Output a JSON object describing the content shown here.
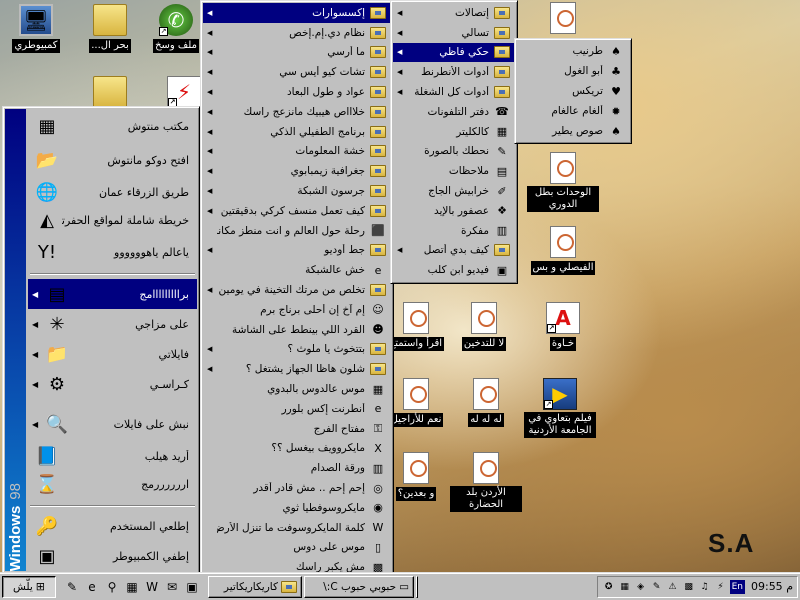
{
  "desktop": {
    "icons": [
      {
        "label": "كمبيوطري",
        "glyph": "🖥"
      },
      {
        "label": "بحر ال...",
        "glyph": ""
      },
      {
        "label": "ملف وسخ",
        "glyph": "✆"
      },
      {
        "label": "",
        "glyph": ""
      },
      {
        "label": "",
        "glyph": ""
      },
      {
        "label": "الوحدات بطل الدوري",
        "glyph": ""
      },
      {
        "label": "الفيصلي و بس",
        "glyph": ""
      },
      {
        "label": "اقرأ واستمتع",
        "glyph": ""
      },
      {
        "label": "لا للتدخين",
        "glyph": ""
      },
      {
        "label": "خـاوة",
        "glyph": "A"
      },
      {
        "label": "نعم للأراجيل",
        "glyph": ""
      },
      {
        "label": "له له له",
        "glyph": ""
      },
      {
        "label": "فيلم بتعاوي في الجامعة الأردنية",
        "glyph": "▶"
      },
      {
        "label": "و بعدين؟",
        "glyph": ""
      },
      {
        "label": "الأردن بلد الحضارة",
        "glyph": ""
      },
      {
        "label": "",
        "glyph": ""
      }
    ],
    "watermark": "S.A"
  },
  "start_menu": {
    "banner_bold": "Windows",
    "banner_light": "98",
    "items": [
      {
        "label": "مكتب منتوش",
        "icon": "▦",
        "has_sub": false
      },
      {
        "label": "افتح دوكو مانتوش",
        "icon": "📂",
        "has_sub": false
      },
      {
        "label": "طريق الزرقاء عمان",
        "icon": "🌐",
        "has_sub": false
      },
      {
        "label": "خريطة شاملة لمواقع الحفرتل",
        "icon": "◭",
        "has_sub": false
      },
      {
        "label": "ياعالم ياهوووووو",
        "icon": "Y!",
        "has_sub": false
      },
      {
        "label": "برااااااااامج",
        "icon": "▤",
        "has_sub": true
      },
      {
        "label": "على مزاجي",
        "icon": "✳",
        "has_sub": true
      },
      {
        "label": "فايلاتي",
        "icon": "📁",
        "has_sub": true
      },
      {
        "label": "كـراسـي",
        "icon": "⚙",
        "has_sub": true
      },
      {
        "label": "نبش على فايلات",
        "icon": "🔍",
        "has_sub": true
      },
      {
        "label": "أريد هيلب",
        "icon": "📘",
        "has_sub": false
      },
      {
        "label": "اررررررمج",
        "icon": "⌛",
        "has_sub": false
      },
      {
        "label": "إطلعي المستخدم",
        "icon": "🔑",
        "has_sub": false
      },
      {
        "label": "إطفي الكمبيوطر",
        "icon": "▣",
        "has_sub": false
      }
    ]
  },
  "programs_menu": {
    "items": [
      {
        "label": "إكسسوارات",
        "icon": "folder",
        "has_sub": true
      },
      {
        "label": "نظام دي.إم.إخص",
        "icon": "folder",
        "has_sub": true
      },
      {
        "label": "ما أرسي",
        "icon": "folder",
        "has_sub": true
      },
      {
        "label": "تشات كيو أيس سي",
        "icon": "folder",
        "has_sub": true
      },
      {
        "label": "عواد و طول البعاد",
        "icon": "folder",
        "has_sub": true
      },
      {
        "label": "خلاااص هيبيك مانزعج راسك",
        "icon": "folder",
        "has_sub": true
      },
      {
        "label": "برنامج الطفيلي الذكي",
        "icon": "folder",
        "has_sub": true
      },
      {
        "label": "خشة المعلومات",
        "icon": "folder",
        "has_sub": true
      },
      {
        "label": "جغرافية زيمبابوي",
        "icon": "folder",
        "has_sub": true
      },
      {
        "label": "جرسون الشبكة",
        "icon": "folder",
        "has_sub": true
      },
      {
        "label": "كيف تعمل منسف كركي بدقيقتين",
        "icon": "folder",
        "has_sub": true
      },
      {
        "label": "رحلة حول العالم و انت منطز مكانك",
        "icon": "⬛",
        "has_sub": false
      },
      {
        "label": "جط أوديو",
        "icon": "folder",
        "has_sub": true
      },
      {
        "label": "خش عالشبكة",
        "icon": "e",
        "has_sub": false
      },
      {
        "label": "تخلص من مرتك التخينة في يومين",
        "icon": "folder",
        "has_sub": true
      },
      {
        "label": "إم آخ إن أحلى برناج برم",
        "icon": "☺",
        "has_sub": false
      },
      {
        "label": "القرد اللي بينطط على الشاشة",
        "icon": "☻",
        "has_sub": false
      },
      {
        "label": "بتتخوث يا ملوث ؟",
        "icon": "folder",
        "has_sub": true
      },
      {
        "label": "شلون هاظا الجهاز يشتغل ؟",
        "icon": "folder",
        "has_sub": true
      },
      {
        "label": "موس عالدوس بالبدوي",
        "icon": "▦",
        "has_sub": false
      },
      {
        "label": "أنطرنت إكس بلورر",
        "icon": "e",
        "has_sub": false
      },
      {
        "label": "مفتاح الفرج",
        "icon": "⚿",
        "has_sub": false
      },
      {
        "label": "مايكروويف بيغسل ؟؟",
        "icon": "X",
        "has_sub": false
      },
      {
        "label": "ورقة الصدام",
        "icon": "▥",
        "has_sub": false
      },
      {
        "label": "إحم إحم .. مش قادر أقدر",
        "icon": "◎",
        "has_sub": false
      },
      {
        "label": "مايكروسوفطيا ثوي",
        "icon": "◉",
        "has_sub": false
      },
      {
        "label": "كلمة المايكروسوفت ما تنزل الأرض",
        "icon": "W",
        "has_sub": false
      },
      {
        "label": "موس على دوس",
        "icon": "▯",
        "has_sub": false
      },
      {
        "label": "مش يكبر راسك",
        "icon": "▩",
        "has_sub": false
      }
    ],
    "scroll_down": "▼"
  },
  "accessories_menu": {
    "items": [
      {
        "label": "إتصالات",
        "icon": "folder",
        "has_sub": true
      },
      {
        "label": "تسالي",
        "icon": "folder",
        "has_sub": true
      },
      {
        "label": "حكي فاظي",
        "icon": "folder",
        "has_sub": true
      },
      {
        "label": "أدوات الأنطرنط",
        "icon": "folder",
        "has_sub": true
      },
      {
        "label": "أدوات كل الشغلة",
        "icon": "folder",
        "has_sub": true
      },
      {
        "label": "دفتر التلفونات",
        "icon": "☎",
        "has_sub": false
      },
      {
        "label": "كالكليتر",
        "icon": "▦",
        "has_sub": false
      },
      {
        "label": "نحطك بالصورة",
        "icon": "✎",
        "has_sub": false
      },
      {
        "label": "ملاحظات",
        "icon": "▤",
        "has_sub": false
      },
      {
        "label": "خرابيش الجاج",
        "icon": "✐",
        "has_sub": false
      },
      {
        "label": "عصفور بالإيد",
        "icon": "❖",
        "has_sub": false
      },
      {
        "label": "مفكرة",
        "icon": "▥",
        "has_sub": false
      },
      {
        "label": "كيف بدي أتصل",
        "icon": "folder",
        "has_sub": true
      },
      {
        "label": "فيديو ابن كلب",
        "icon": "▣",
        "has_sub": false
      }
    ]
  },
  "games_menu": {
    "items": [
      {
        "label": "طرنيب",
        "icon": "♠"
      },
      {
        "label": "أبو الغول",
        "icon": "♣"
      },
      {
        "label": "تريكس",
        "icon": "♥"
      },
      {
        "label": "ألغام عالغام",
        "icon": "✹"
      },
      {
        "label": "صوص يطير",
        "icon": "♠"
      }
    ]
  },
  "taskbar": {
    "start_label": "يلّش",
    "quick_launch": [
      "✎",
      "e",
      "⚲",
      "▦",
      "W",
      "✉",
      "▣"
    ],
    "buttons": [
      {
        "label": "كاريكاريكاتير",
        "pressed": false
      },
      {
        "label": "حبوبي حبوب C:\\",
        "pressed": false
      },
      {
        "label": "",
        "pressed": false
      }
    ],
    "tray_icons": [
      "✪",
      "▦",
      "◈",
      "✎",
      "⚠",
      "▩",
      "♫",
      "⚡"
    ],
    "lang": "En",
    "clock": "09:55 م"
  }
}
